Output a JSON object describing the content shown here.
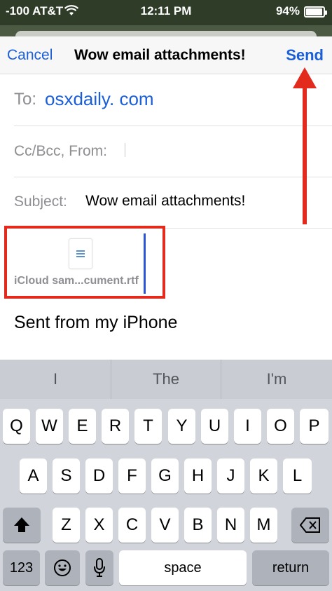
{
  "status_bar": {
    "carrier": "-100 AT&T",
    "time": "12:11 PM",
    "battery_percent": "94%",
    "battery_level": 0.94,
    "wifi_icon": "wifi-icon"
  },
  "nav": {
    "cancel_label": "Cancel",
    "title": "Wow email attachments!",
    "send_label": "Send"
  },
  "compose": {
    "to_label": "To:",
    "to_value": "osxdaily. com",
    "cc_label": "Cc/Bcc, From:",
    "subject_label": "Subject:",
    "subject_value": "Wow email attachments!",
    "attachment_name": "iCloud sam...cument.rtf",
    "attachment_icon": "document-icon",
    "signature": "Sent from my iPhone"
  },
  "annotation_colors": {
    "highlight": "#e22a1d",
    "arrow": "#e22a1d"
  },
  "keyboard": {
    "suggestions": [
      "I",
      "The",
      "I'm"
    ],
    "row1": [
      "Q",
      "W",
      "E",
      "R",
      "T",
      "Y",
      "U",
      "I",
      "O",
      "P"
    ],
    "row2": [
      "A",
      "S",
      "D",
      "F",
      "G",
      "H",
      "J",
      "K",
      "L"
    ],
    "row3": [
      "Z",
      "X",
      "C",
      "V",
      "B",
      "N",
      "M"
    ],
    "numbers_label": "123",
    "space_label": "space",
    "return_label": "return",
    "shift_icon": "shift-icon",
    "backspace_icon": "backspace-icon",
    "emoji_icon": "emoji-icon",
    "mic_icon": "microphone-icon"
  }
}
